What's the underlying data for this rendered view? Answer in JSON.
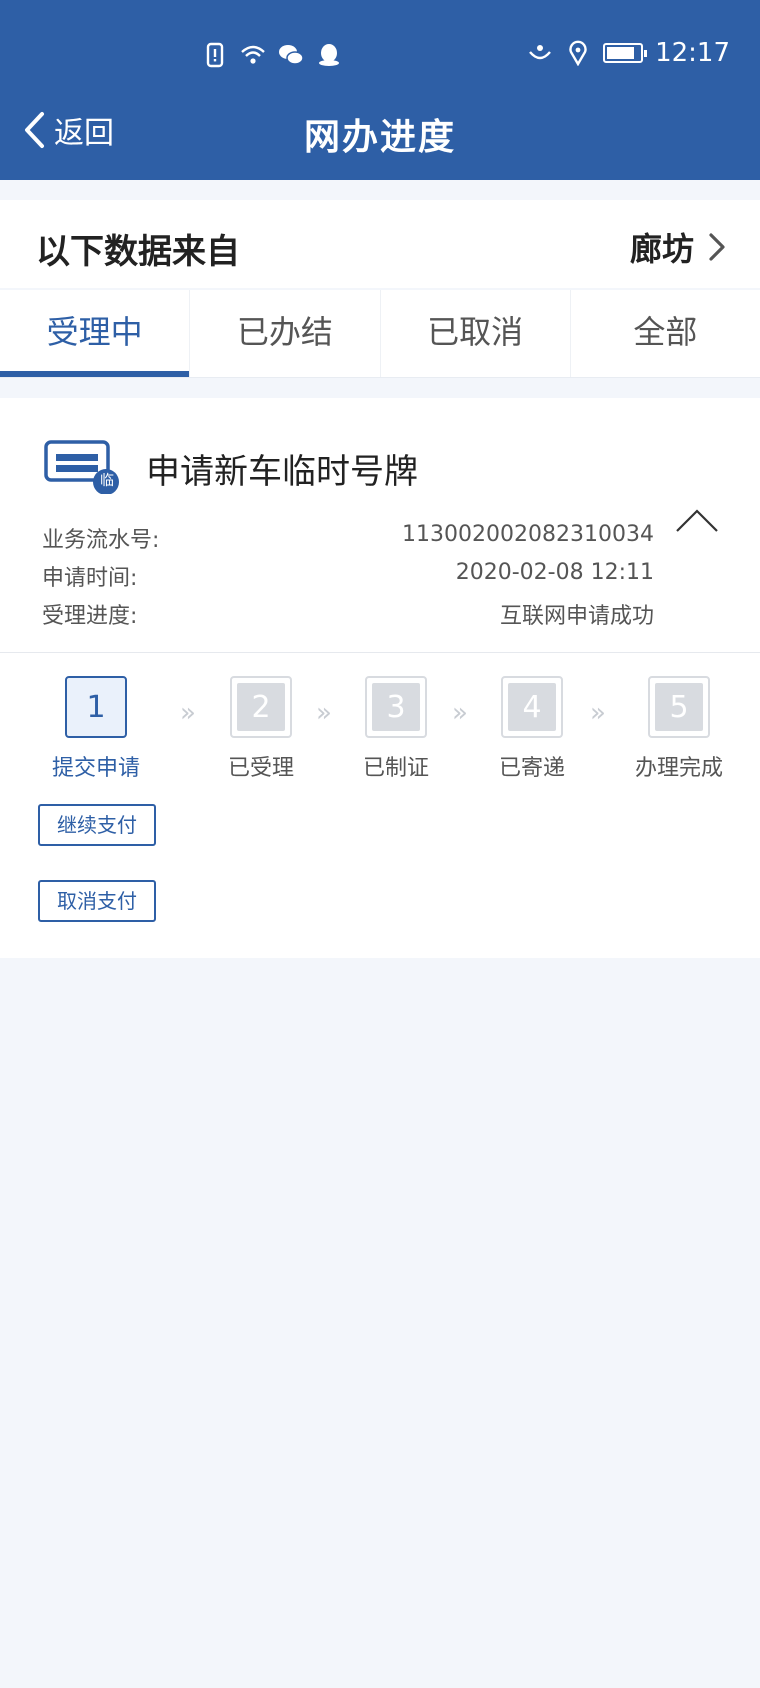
{
  "status_bar": {
    "time": "12:17",
    "battery_level": 0.85
  },
  "nav": {
    "back_label": "返回",
    "title": "网办进度"
  },
  "source": {
    "label": "以下数据来自",
    "city": "廊坊"
  },
  "tabs": [
    {
      "label": "受理中",
      "active": true
    },
    {
      "label": "已办结",
      "active": false
    },
    {
      "label": "已取消",
      "active": false
    },
    {
      "label": "全部",
      "active": false
    }
  ],
  "card": {
    "icon_badge": "临",
    "title": "申请新车临时号牌",
    "rows": [
      {
        "label": "业务流水号:",
        "value": "113002002082310034"
      },
      {
        "label": "申请时间:",
        "value": "2020-02-08 12:11"
      },
      {
        "label": "受理进度:",
        "value": "互联网申请成功"
      }
    ],
    "steps": [
      {
        "num": "1",
        "label": "提交申请"
      },
      {
        "num": "2",
        "label": "已受理"
      },
      {
        "num": "3",
        "label": "已制证"
      },
      {
        "num": "4",
        "label": "已寄递"
      },
      {
        "num": "5",
        "label": "办理完成"
      }
    ],
    "current_step": 1,
    "buttons": {
      "continue_pay": "继续支付",
      "cancel_pay": "取消支付"
    }
  },
  "colors": {
    "primary": "#2e5fa6",
    "background": "#f3f6fb",
    "inactive_step": "#d8dbe0"
  }
}
